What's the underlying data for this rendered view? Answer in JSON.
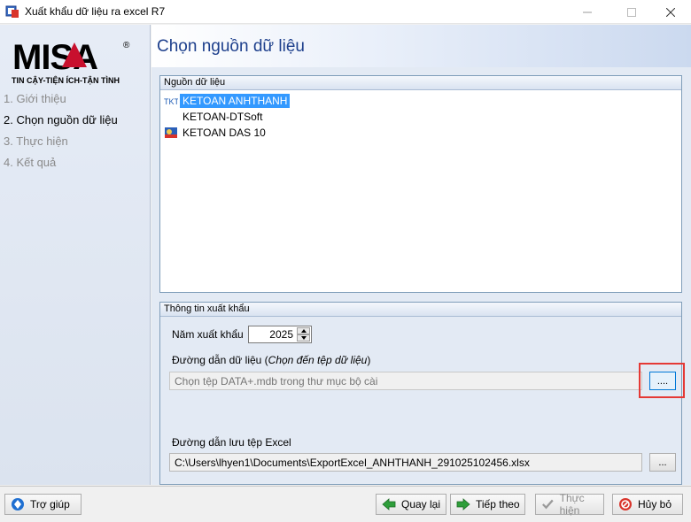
{
  "window": {
    "title": "Xuất khẩu dữ liệu ra excel R7"
  },
  "logo": {
    "brand": "MISA",
    "registered": "®",
    "tagline": "TIN CẬY-TIỆN ÍCH-TẬN TÌNH"
  },
  "steps": [
    {
      "label": "1. Giới thiệu",
      "active": false
    },
    {
      "label": "2. Chọn nguồn dữ liệu",
      "active": true
    },
    {
      "label": "3. Thực hiện",
      "active": false
    },
    {
      "label": "4. Kết quả",
      "active": false
    }
  ],
  "header": {
    "title": "Chọn nguồn dữ liệu"
  },
  "source_group": {
    "title": "Nguồn dữ liệu",
    "items": [
      {
        "label": "KETOAN ANHTHANH",
        "selected": true,
        "icon": "tkt-icon"
      },
      {
        "label": "KETOAN-DTSoft",
        "selected": false,
        "icon": "none"
      },
      {
        "label": "KETOAN DAS 10",
        "selected": false,
        "icon": "das-icon"
      }
    ]
  },
  "export_group": {
    "title": "Thông tin xuất khẩu",
    "year_label": "Năm xuất khẩu",
    "year_value": "2025",
    "data_path_label": "Đường dẫn dữ liệu (",
    "data_path_hint": "Chọn đến tệp dữ liệu",
    "data_path_label_end": ")",
    "data_path_placeholder": "Chọn tệp DATA+.mdb trong thư mục bộ cài",
    "browse_label": "....",
    "excel_path_label": "Đường dẫn lưu tệp Excel",
    "excel_path_value": "C:\\Users\\lhyen1\\Documents\\ExportExcel_ANHTHANH_291025102456.xlsx",
    "excel_browse_label": "..."
  },
  "footer": {
    "help": "Trợ giúp",
    "back": "Quay lại",
    "next": "Tiếp theo",
    "run": "Thực hiện",
    "cancel": "Hủy bỏ"
  },
  "colors": {
    "title_blue": "#1d3f8c",
    "selection": "#3399ff",
    "highlight": "#e53935",
    "logo_red": "#c8102e"
  }
}
